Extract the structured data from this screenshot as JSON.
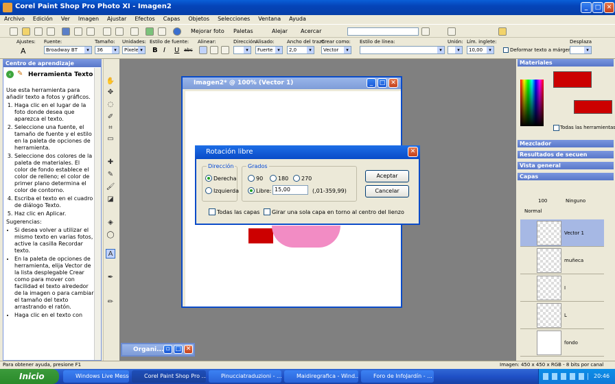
{
  "app": {
    "title": "Corel Paint Shop Pro Photo XI - Imagen2"
  },
  "menu": [
    "Archivo",
    "Edición",
    "Ver",
    "Imagen",
    "Ajustar",
    "Efectos",
    "Capas",
    "Objetos",
    "Selecciones",
    "Ventana",
    "Ayuda"
  ],
  "toolbar": {
    "enhance": "Mejorar foto",
    "palettes": "Paletas",
    "zoom_out": "Alejar",
    "zoom_in": "Acercar"
  },
  "options": {
    "presets": "Ajustes:",
    "font_label": "Fuente:",
    "font": "Broadway BT",
    "size_label": "Tamaño:",
    "size": "36",
    "units_label": "Unidades:",
    "units": "Píxeles",
    "style_label": "Estilo de fuente:",
    "bold": "B",
    "italic": "I",
    "underline": "U",
    "strike": "abc",
    "align_label": "Alinear:",
    "direction_label": "Dirección:",
    "antialias_label": "Alisado:",
    "antialias": "Fuerte",
    "stroke_label": "Ancho del trazo:",
    "stroke": "2,0",
    "create_label": "Crear como:",
    "create": "Vector",
    "linestyle_label": "Estilo de línea:",
    "join_label": "Unión:",
    "miter_label": "Lím. inglete:",
    "miter": "10,00",
    "kerning_label": "Desplaza",
    "warp": "Deformar texto a márgenes"
  },
  "learn": {
    "header": "Centro de aprendizaje",
    "title": "Herramienta Texto",
    "intro": "Use esta herramienta para añadir texto a fotos y gráficos.",
    "steps": [
      "Haga clic en el lugar de la foto donde desea que aparezca el texto.",
      "Seleccione una fuente, el tamaño de fuente y el estilo en la paleta de opciones de herramienta.",
      "Seleccione dos colores de la paleta de materiales. El color de fondo establece el color de relleno; el color de primer plano determina el color de contorno.",
      "Escriba el texto en el cuadro de diálogo Texto.",
      "Haz clic en Aplicar."
    ],
    "tips_title": "Sugerencias:",
    "tips": [
      "Si desea volver a utilizar el mismo texto en varias fotos, active la casilla Recordar texto.",
      "En la paleta de opciones de herramienta, elija Vector de la lista desplegable Crear como para mover con facilidad el texto alrededor de la imagen o para cambiar el tamaño del texto arrastrando el ratón.",
      "Haga clic en el texto con"
    ]
  },
  "image_window": {
    "title": "Imagen2* @ 100% (Vector 1)"
  },
  "minimized": {
    "title": "Organi..."
  },
  "dialog": {
    "title": "Rotación libre",
    "direction_group": "Dirección",
    "right": "Derecha",
    "left": "Izquierda",
    "degrees_group": "Grados",
    "d90": "90",
    "d180": "180",
    "d270": "270",
    "free": "Libre:",
    "free_value": "15,00",
    "range": "(,01-359,99)",
    "ok": "Aceptar",
    "cancel": "Cancelar",
    "all_layers": "Todas las capas",
    "single_layer": "Girar una sola capa en torno al centro del lienzo"
  },
  "right": {
    "materials": "Materiales",
    "all_tools": "Todas las herramientas",
    "mixer": "Mezclador",
    "history": "Resultados de secuen",
    "overview": "Vista general",
    "layers": "Capas",
    "opacity": "100",
    "blend_none": "Ninguno",
    "blend_mode": "Normal",
    "layer_list": [
      "Vector 1",
      "muñeca",
      "I",
      "L",
      "fondo"
    ]
  },
  "status": {
    "help": "Para obtener ayuda, presione F1",
    "image_info": "Imagen: 450 x 450 x RGB - 8 bits por canal"
  },
  "taskbar": {
    "start": "Inicio",
    "tasks": [
      "Windows Live Messen...",
      "Corel Paint Shop Pro ...",
      "Pinucciatraduzioni - ...",
      "Maidiregrafica - Wind...",
      "Foro de InfoJardín - ..."
    ],
    "clock": "20:46"
  },
  "colors": {
    "foreground": "#cc0000",
    "background": "#ffffff",
    "accent": "#0a4bc8"
  }
}
